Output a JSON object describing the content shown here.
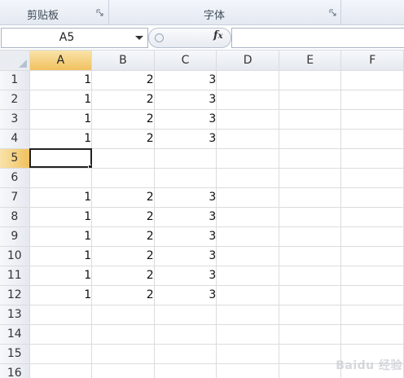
{
  "ribbon": {
    "groups": [
      {
        "label": "剪贴板"
      },
      {
        "label": "字体"
      }
    ]
  },
  "formula_bar": {
    "name_box": "A5",
    "fx_label": "fx",
    "formula_value": ""
  },
  "columns": [
    "A",
    "B",
    "C",
    "D",
    "E",
    "F"
  ],
  "active_column": "A",
  "active_row": "5",
  "rows": [
    {
      "num": "1",
      "cells": [
        "1",
        "2",
        "3",
        "",
        "",
        ""
      ]
    },
    {
      "num": "2",
      "cells": [
        "1",
        "2",
        "3",
        "",
        "",
        ""
      ]
    },
    {
      "num": "3",
      "cells": [
        "1",
        "2",
        "3",
        "",
        "",
        ""
      ]
    },
    {
      "num": "4",
      "cells": [
        "1",
        "2",
        "3",
        "",
        "",
        ""
      ]
    },
    {
      "num": "5",
      "cells": [
        "",
        "",
        "",
        "",
        "",
        ""
      ]
    },
    {
      "num": "6",
      "cells": [
        "",
        "",
        "",
        "",
        "",
        ""
      ]
    },
    {
      "num": "7",
      "cells": [
        "1",
        "2",
        "3",
        "",
        "",
        ""
      ]
    },
    {
      "num": "8",
      "cells": [
        "1",
        "2",
        "3",
        "",
        "",
        ""
      ]
    },
    {
      "num": "9",
      "cells": [
        "1",
        "2",
        "3",
        "",
        "",
        ""
      ]
    },
    {
      "num": "10",
      "cells": [
        "1",
        "2",
        "3",
        "",
        "",
        ""
      ]
    },
    {
      "num": "11",
      "cells": [
        "1",
        "2",
        "3",
        "",
        "",
        ""
      ]
    },
    {
      "num": "12",
      "cells": [
        "1",
        "2",
        "3",
        "",
        "",
        ""
      ]
    },
    {
      "num": "13",
      "cells": [
        "",
        "",
        "",
        "",
        "",
        ""
      ]
    },
    {
      "num": "14",
      "cells": [
        "",
        "",
        "",
        "",
        "",
        ""
      ]
    },
    {
      "num": "15",
      "cells": [
        "",
        "",
        "",
        "",
        "",
        ""
      ]
    },
    {
      "num": "16",
      "cells": [
        "",
        "",
        "",
        "",
        "",
        ""
      ]
    }
  ],
  "watermark": "Baidu 经验"
}
